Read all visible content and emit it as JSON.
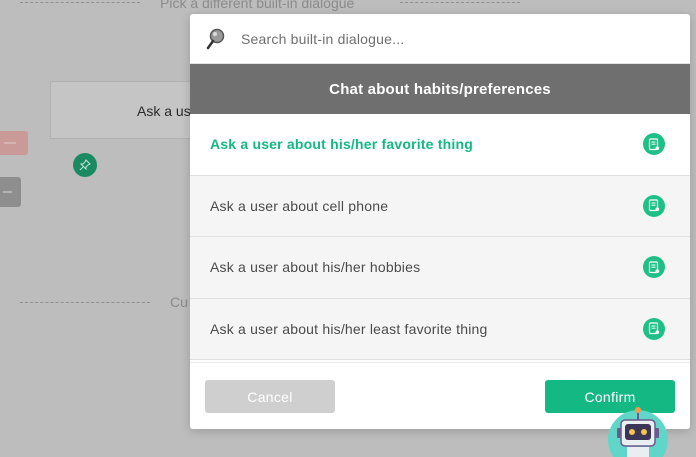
{
  "background": {
    "top_heading": "Pick a different built-in dialogue",
    "card_text": "Ask a us",
    "bottom_heading": "Cu"
  },
  "search": {
    "placeholder": "Search built-in dialogue...",
    "value": ""
  },
  "category": {
    "title": "Chat about habits/preferences"
  },
  "dialogues": [
    {
      "label": "Ask a user about his/her favorite thing",
      "selected": true
    },
    {
      "label": "Ask a user about cell phone",
      "selected": false
    },
    {
      "label": "Ask a user about his/her hobbies",
      "selected": false
    },
    {
      "label": "Ask a user about his/her least favorite thing",
      "selected": false
    }
  ],
  "footer": {
    "cancel_label": "Cancel",
    "confirm_label": "Confirm"
  },
  "icons": {
    "search": "magnifier-icon",
    "dialogue": "document-icon",
    "pin": "pin-icon",
    "mascot": "robot-icon"
  },
  "colors": {
    "accent": "#13b883",
    "header_bg": "#6f6f6f",
    "cancel_bg": "#cfcfcf",
    "overlay": "#bdbdbd"
  }
}
